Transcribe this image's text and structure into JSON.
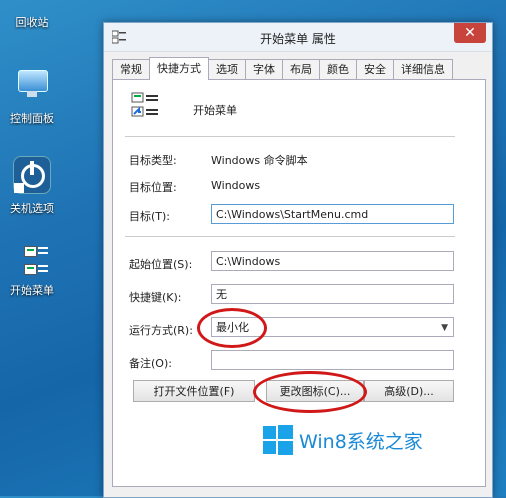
{
  "desktop": {
    "icons": [
      {
        "label": "回收站"
      },
      {
        "label": "控制面板"
      },
      {
        "label": "关机选项"
      },
      {
        "label": "开始菜单"
      }
    ]
  },
  "dialog": {
    "title": "开始菜单 属性",
    "close_glyph": "✕",
    "tabs": [
      "常规",
      "快捷方式",
      "选项",
      "字体",
      "布局",
      "颜色",
      "安全",
      "详细信息"
    ],
    "active_tab": "快捷方式",
    "shortcut_name": "开始菜单",
    "target_type_label": "目标类型:",
    "target_type_value": "Windows 命令脚本",
    "target_location_label": "目标位置:",
    "target_location_value": "Windows",
    "target_label": "目标(T):",
    "target_value": "C:\\Windows\\StartMenu.cmd",
    "start_in_label": "起始位置(S):",
    "start_in_value": "C:\\Windows",
    "hotkey_label": "快捷键(K):",
    "hotkey_value": "无",
    "run_label": "运行方式(R):",
    "run_value": "最小化",
    "comment_label": "备注(O):",
    "comment_value": "",
    "open_location_button": "打开文件位置(F)",
    "change_icon_button": "更改图标(C)...",
    "advanced_button": "高级(D)..."
  },
  "watermark": {
    "text": "Win8系统之家",
    "color": "#1a8ad6"
  },
  "colors": {
    "highlight_oval": "#d01818",
    "close_button": "#c7443c"
  }
}
